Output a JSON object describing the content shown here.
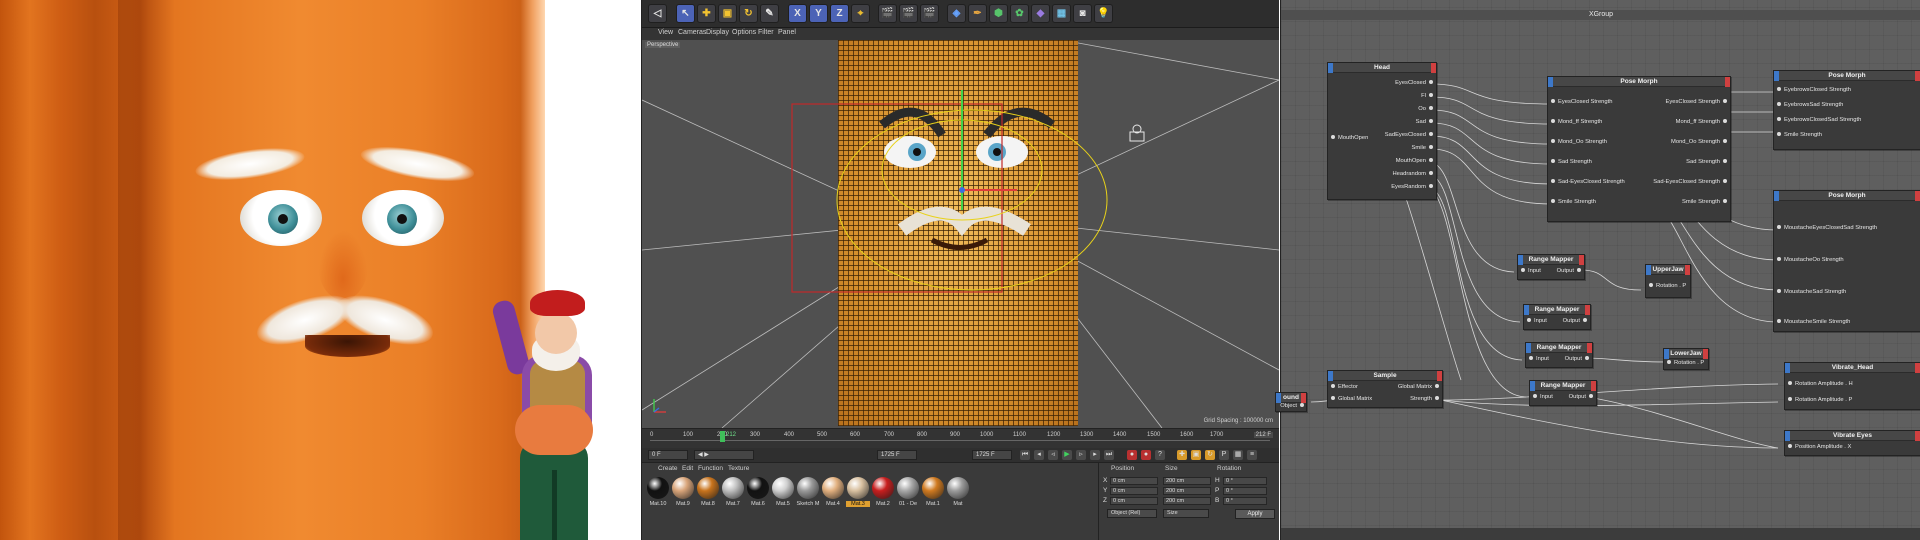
{
  "viewport": {
    "camera_label": "Perspective",
    "grid_spacing": "Grid Spacing : 100000 cm"
  },
  "menu": [
    "View",
    "Cameras",
    "Display",
    "Options",
    "Filter",
    "Panel"
  ],
  "toolbar": {
    "axis_x": "X",
    "axis_y": "Y",
    "axis_z": "Z"
  },
  "timeline": {
    "ticks": [
      "0",
      "100",
      "200",
      "300",
      "400",
      "500",
      "600",
      "700",
      "800",
      "900",
      "1000",
      "1100",
      "1200",
      "1300",
      "1400",
      "1500",
      "1600",
      "1700"
    ],
    "current_frame": "212",
    "end_frame": "212 F",
    "start_field": "0 F",
    "end_field": "1725 F",
    "range_field": "1725 F"
  },
  "materials_panel": {
    "menu": [
      "Create",
      "Edit",
      "Function",
      "Texture"
    ],
    "items": [
      {
        "name": "Mat.10",
        "color": "#111111"
      },
      {
        "name": "Mat.9",
        "color": "#d9a57a"
      },
      {
        "name": "Mat.8",
        "color": "#c8731c"
      },
      {
        "name": "Mat.7",
        "color": "#bfbfbf"
      },
      {
        "name": "Mat.6",
        "color": "#121212"
      },
      {
        "name": "Mat.5",
        "color": "#d0d0d0"
      },
      {
        "name": "Sketch M",
        "color": "#9a9a9a"
      },
      {
        "name": "Mat.4",
        "color": "#e2b07f"
      },
      {
        "name": "Mat.3",
        "color": "#d8c0a0",
        "selected": true
      },
      {
        "name": "Mat.2",
        "color": "#c81e1e"
      },
      {
        "name": "01 - De",
        "color": "#a8a8a8"
      },
      {
        "name": "Mat.1",
        "color": "#d07a20"
      },
      {
        "name": "Mat",
        "color": "#9c9c9c"
      }
    ]
  },
  "coordinates": {
    "headers": [
      "Position",
      "Size",
      "Rotation"
    ],
    "rows": [
      {
        "axis": "X",
        "position": "0 cm",
        "size": "200 cm",
        "rot_label": "H",
        "rotation": "0 °"
      },
      {
        "axis": "Y",
        "position": "0 cm",
        "size": "200 cm",
        "rot_label": "P",
        "rotation": "0 °"
      },
      {
        "axis": "Z",
        "position": "0 cm",
        "size": "200 cm",
        "rot_label": "B",
        "rotation": "0 °"
      }
    ],
    "mode": "Object (Rel)",
    "size_mode": "Size",
    "apply_label": "Apply"
  },
  "xgroup": {
    "title": "XGroup",
    "nodes": {
      "head": {
        "title": "Head",
        "input": "MouthOpen",
        "outputs": [
          "EyesClosed",
          "Fl",
          "Oo",
          "Sad",
          "SadEyesClosed",
          "Smile",
          "MouthOpen",
          "Headrandom",
          "EyesRandom"
        ]
      },
      "pose_morph_1": {
        "title": "Pose Morph",
        "inputs": [
          "EyesClosed Strength",
          "Mond_ff Strength",
          "Mond_Oo Strength",
          "Sad Strength",
          "Sad-EyesClosed Strength",
          "Smile Strength"
        ],
        "outputs": [
          "EyesClosed Strength",
          "Mond_ff Strength",
          "Mond_Oo Strength",
          "Sad Strength",
          "Sad-EyesClosed Strength",
          "Smile Strength"
        ]
      },
      "pose_morph_2": {
        "title": "Pose Morph",
        "inputs": [
          "EyebrowsClosed Strength",
          "EyebrowsSad Strength",
          "EyebrowsClosedSad Strength",
          "Smile Strength"
        ]
      },
      "pose_morph_3": {
        "title": "Pose Morph",
        "inputs": [
          "MoustacheEyesClosedSad Strength",
          "MoustacheOo Strength",
          "MoustacheSad Strength",
          "MoustacheSmile Strength"
        ]
      },
      "range_1": {
        "title": "Range Mapper",
        "input": "Input",
        "output": "Output"
      },
      "range_2": {
        "title": "Range Mapper",
        "input": "Input",
        "output": "Output"
      },
      "range_3": {
        "title": "Range Mapper",
        "input": "Input",
        "output": "Output"
      },
      "range_4": {
        "title": "Range Mapper",
        "input": "Input",
        "output": "Output"
      },
      "upper_jaw": {
        "title": "UpperJaw",
        "input": "Rotation . P"
      },
      "lower_jaw": {
        "title": "LowerJaw",
        "input": "Rotation . P"
      },
      "sample": {
        "title": "Sample",
        "inputs": [
          "Effector",
          "Global Matrix"
        ],
        "outputs": [
          "Global Matrix",
          "Strength"
        ]
      },
      "sound": {
        "title": "ound",
        "output": "Object"
      },
      "vibrate_head": {
        "title": "Vibrate_Head",
        "inputs": [
          "Rotation Amplitude . H",
          "Rotation Amplitude . P"
        ]
      },
      "vibrate_eyes": {
        "title": "Vibrate Eyes",
        "inputs": [
          "Position Amplitude . X"
        ]
      }
    }
  }
}
